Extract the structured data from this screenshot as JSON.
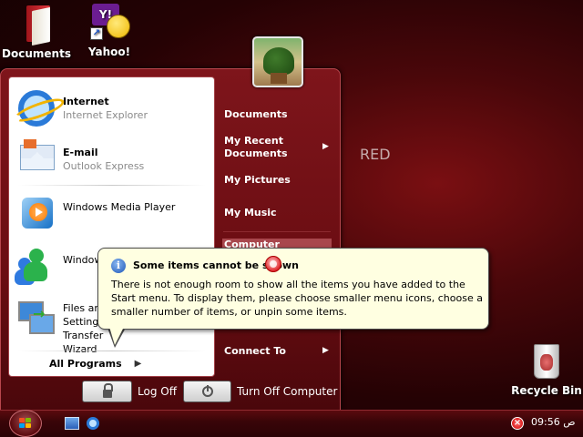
{
  "desktop": {
    "icons": [
      {
        "label": "Documents",
        "icon": "folder-icon"
      },
      {
        "label": "Yahoo!",
        "icon": "yahoo-messenger-icon"
      },
      {
        "label": "Recycle Bin",
        "icon": "recycle-bin-icon"
      }
    ],
    "watermark": "RED"
  },
  "start_menu": {
    "pinned": [
      {
        "name": "Internet",
        "sub": "Internet Explorer",
        "icon": "internet-explorer-icon"
      },
      {
        "name": "E-mail",
        "sub": "Outlook Express",
        "icon": "outlook-express-icon"
      }
    ],
    "recent": [
      {
        "name": "Windows Media Player",
        "icon": "windows-media-player-icon"
      },
      {
        "name": "Windows Messenger",
        "icon": "windows-messenger-icon"
      },
      {
        "name": "Files and Settings Transfer Wizard",
        "icon": "transfer-wizard-icon"
      }
    ],
    "all_programs": "All Programs",
    "right": {
      "documents": "Documents",
      "recent_documents": "My Recent Documents",
      "pictures": "My Pictures",
      "music": "My Music",
      "computer": "Computer",
      "connect_to": "Connect To"
    },
    "log_off": "Log Off",
    "turn_off": "Turn Off Computer"
  },
  "balloon": {
    "title": "Some items cannot be shown",
    "text": "There is not enough room to show all the items you have added to the Start menu.  To display them, please choose smaller menu icons, choose a smaller number of items, or unpin some items."
  },
  "taskbar": {
    "clock": "09:56 ص",
    "quick_launch": [
      "show-desktop-icon",
      "internet-explorer-icon"
    ]
  },
  "colors": {
    "menu_bg": "#6a0d12",
    "highlight": "#a8474d",
    "balloon_bg": "#ffffe1"
  }
}
